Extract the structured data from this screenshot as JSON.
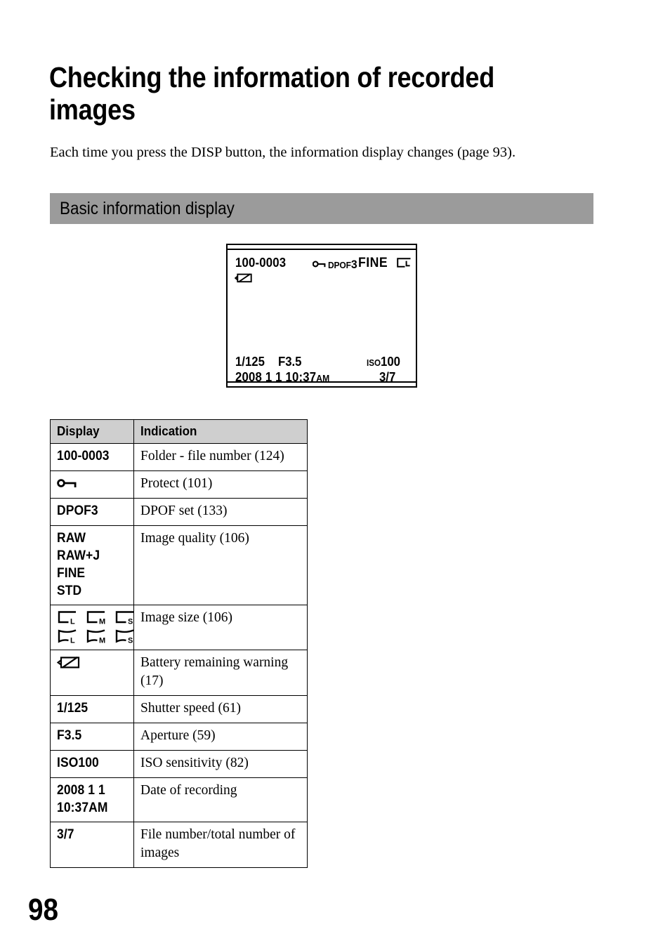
{
  "page": {
    "title": "Checking the information of recorded images",
    "intro": "Each time you press the DISP button, the information display changes (page 93).",
    "page_number": "98",
    "section_heading": "Basic information display",
    "section_bar_color": "#9b9b9b",
    "table_header_color": "#cfcfcf"
  },
  "lcd_display": {
    "folder_file_number": "100-0003",
    "protect_icon": "key-icon",
    "dpof_label": "DPOF",
    "dpof_number": "3",
    "image_quality": "FINE",
    "image_size_icon": "size-L-icon",
    "battery_icon": "battery-warning-icon",
    "shutter_speed": "1/125",
    "aperture": "F3.5",
    "iso_label": "ISO",
    "iso_value": "100",
    "date": "2008  1  1 10:37",
    "ampm": "AM",
    "file_index": "3/7"
  },
  "table": {
    "headers": [
      "Display",
      "Indication"
    ],
    "rows": [
      {
        "display_lines": [
          "100-0003"
        ],
        "icons": [],
        "indication": "Folder - file number (124)"
      },
      {
        "display_lines": [],
        "icons": [
          "key-icon"
        ],
        "indication": "Protect (101)"
      },
      {
        "display_lines": [
          "DPOF3"
        ],
        "icons": [],
        "indication": "DPOF set (133)"
      },
      {
        "display_lines": [
          "RAW",
          "RAW+J",
          "FINE",
          "STD"
        ],
        "icons": [],
        "indication": "Image quality (106)"
      },
      {
        "display_lines": [],
        "icons": [
          "size-L-icon",
          "size-M-icon",
          "size-S-icon",
          "size-wide-L-icon",
          "size-wide-M-icon",
          "size-wide-S-icon"
        ],
        "indication": "Image size (106)"
      },
      {
        "display_lines": [],
        "icons": [
          "battery-warning-icon"
        ],
        "indication": "Battery remaining warning (17)"
      },
      {
        "display_lines": [
          "1/125"
        ],
        "icons": [],
        "indication": "Shutter speed (61)"
      },
      {
        "display_lines": [
          "F3.5"
        ],
        "icons": [],
        "indication": "Aperture (59)"
      },
      {
        "display_lines": [
          "ISO100"
        ],
        "icons": [],
        "indication": "ISO sensitivity (82)"
      },
      {
        "display_lines": [
          "2008  1  1",
          "10:37AM"
        ],
        "icons": [],
        "indication": "Date of recording"
      },
      {
        "display_lines": [
          "3/7"
        ],
        "icons": [],
        "indication": "File number/total number of images"
      }
    ]
  }
}
